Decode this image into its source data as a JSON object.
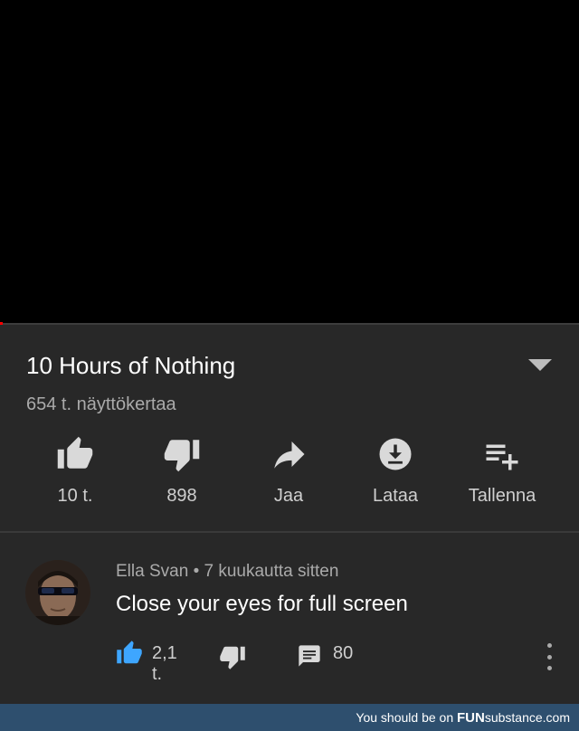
{
  "video": {
    "title": "10 Hours of Nothing",
    "views": "654 t. näyttökertaa"
  },
  "actions": [
    {
      "icon": "thumb-up-icon",
      "label": "10 t."
    },
    {
      "icon": "thumb-down-icon",
      "label": "898"
    },
    {
      "icon": "share-icon",
      "label": "Jaa"
    },
    {
      "icon": "download-icon",
      "label": "Lataa"
    },
    {
      "icon": "playlist-add-icon",
      "label": "Tallenna"
    }
  ],
  "comment": {
    "author": "Ella Svan",
    "separator": "•",
    "time": "7 kuukautta sitten",
    "text": "Close your eyes for full screen",
    "likes": "2,1 t.",
    "replies": "80"
  },
  "banner": {
    "prefix": "You should be on ",
    "brand_fun": "FUN",
    "brand_rest": "substance.com"
  },
  "colors": {
    "background": "#282828",
    "player": "#000000",
    "accent_like": "#3ea6ff",
    "progress": "#ff0000",
    "banner": "#2e4f6e"
  }
}
